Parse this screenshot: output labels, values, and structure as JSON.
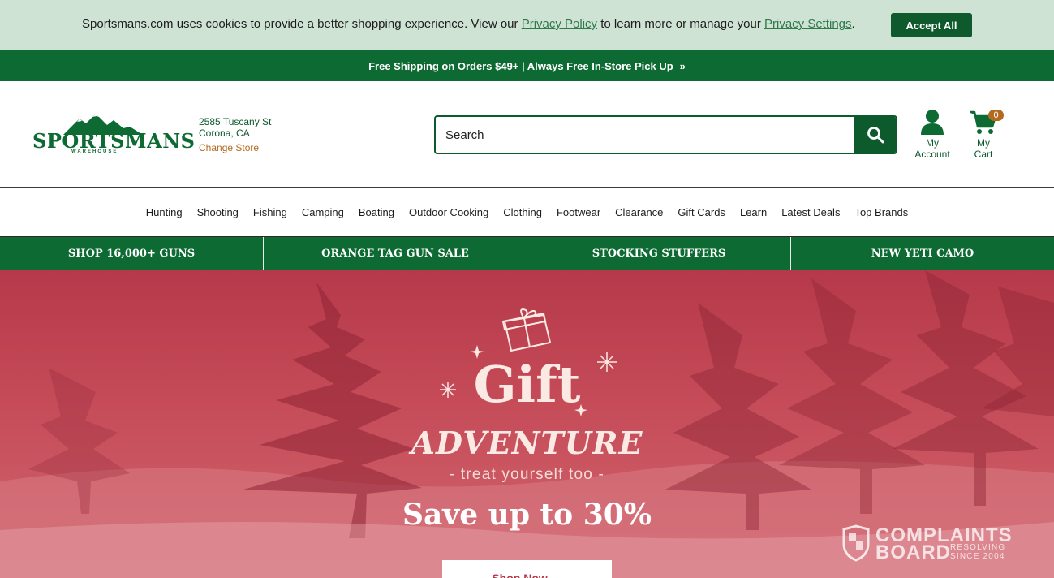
{
  "cookie": {
    "text_before": "Sportsmans.com uses cookies to provide a better shopping experience. View our ",
    "privacy_link": "Privacy Policy",
    "text_middle": " to learn more or manage your ",
    "settings_link": "Privacy Settings",
    "text_after": ".",
    "accept_label": "Accept All"
  },
  "promo": {
    "text": "Free Shipping on Orders $49+ | Always Free In-Store Pick Up",
    "chevron": "»"
  },
  "header": {
    "logo_text": "SPORTSMANS",
    "logo_sub": "WAREHOUSE",
    "store_street": "2585 Tuscany St",
    "store_city": "Corona, CA",
    "change_store": "Change Store",
    "search_placeholder": "Search",
    "account_line1": "My",
    "account_line2": "Account",
    "cart_line1": "My",
    "cart_line2": "Cart",
    "cart_count": "0"
  },
  "nav": {
    "items": [
      "Hunting",
      "Shooting",
      "Fishing",
      "Camping",
      "Boating",
      "Outdoor Cooking",
      "Clothing",
      "Footwear",
      "Clearance",
      "Gift Cards",
      "Learn",
      "Latest Deals",
      "Top Brands"
    ]
  },
  "categories": [
    "SHOP 16,000+ GUNS",
    "ORANGE TAG GUN SALE",
    "STOCKING STUFFERS",
    "NEW YETI CAMO"
  ],
  "hero": {
    "gift": "Gift",
    "adventure": "ADVENTURE",
    "treat": "- treat yourself too -",
    "save": "Save up to 30%",
    "button": "Shop Now →"
  },
  "watermark": {
    "line1": "COMPLAINTS",
    "line2": "BOARD",
    "side1": "RESOLVING",
    "side2": "SINCE 2004"
  },
  "colors": {
    "brand_green": "#0d6a32",
    "accent_orange": "#b46a1e",
    "hero_red": "#b5394a",
    "cookie_bg": "#cfe3d5"
  }
}
